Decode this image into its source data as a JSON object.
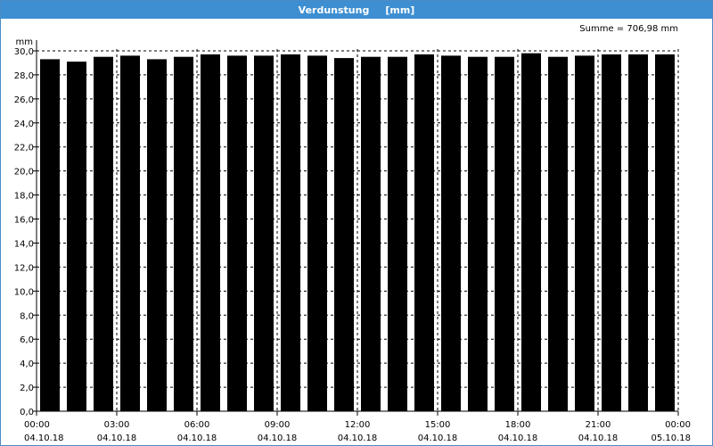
{
  "window": {
    "title": "Verdunstung",
    "unit": "[mm]"
  },
  "summary": "Summe = 706,98 mm",
  "chart_data": {
    "type": "bar",
    "title": "Verdunstung [mm]",
    "ylabel": "mm",
    "xlabel": "",
    "ylim": [
      0,
      30
    ],
    "grid": true,
    "y_ticks": [
      "0,0",
      "2,0",
      "4,0",
      "6,0",
      "8,0",
      "10,0",
      "12,0",
      "14,0",
      "16,0",
      "18,0",
      "20,0",
      "22,0",
      "24,0",
      "26,0",
      "28,0",
      "30,0"
    ],
    "x_ticks": [
      {
        "time": "00:00",
        "date": "04.10.18"
      },
      {
        "time": "03:00",
        "date": "04.10.18"
      },
      {
        "time": "06:00",
        "date": "04.10.18"
      },
      {
        "time": "09:00",
        "date": "04.10.18"
      },
      {
        "time": "12:00",
        "date": "04.10.18"
      },
      {
        "time": "15:00",
        "date": "04.10.18"
      },
      {
        "time": "18:00",
        "date": "04.10.18"
      },
      {
        "time": "21:00",
        "date": "04.10.18"
      },
      {
        "time": "00:00",
        "date": "05.10.18"
      }
    ],
    "bar_color": "#000000",
    "values": [
      29.3,
      29.1,
      29.5,
      29.6,
      29.3,
      29.5,
      29.7,
      29.6,
      29.6,
      29.7,
      29.6,
      29.4,
      29.5,
      29.5,
      29.7,
      29.6,
      29.5,
      29.5,
      29.8,
      29.5,
      29.6,
      29.7,
      29.7,
      29.7
    ]
  }
}
